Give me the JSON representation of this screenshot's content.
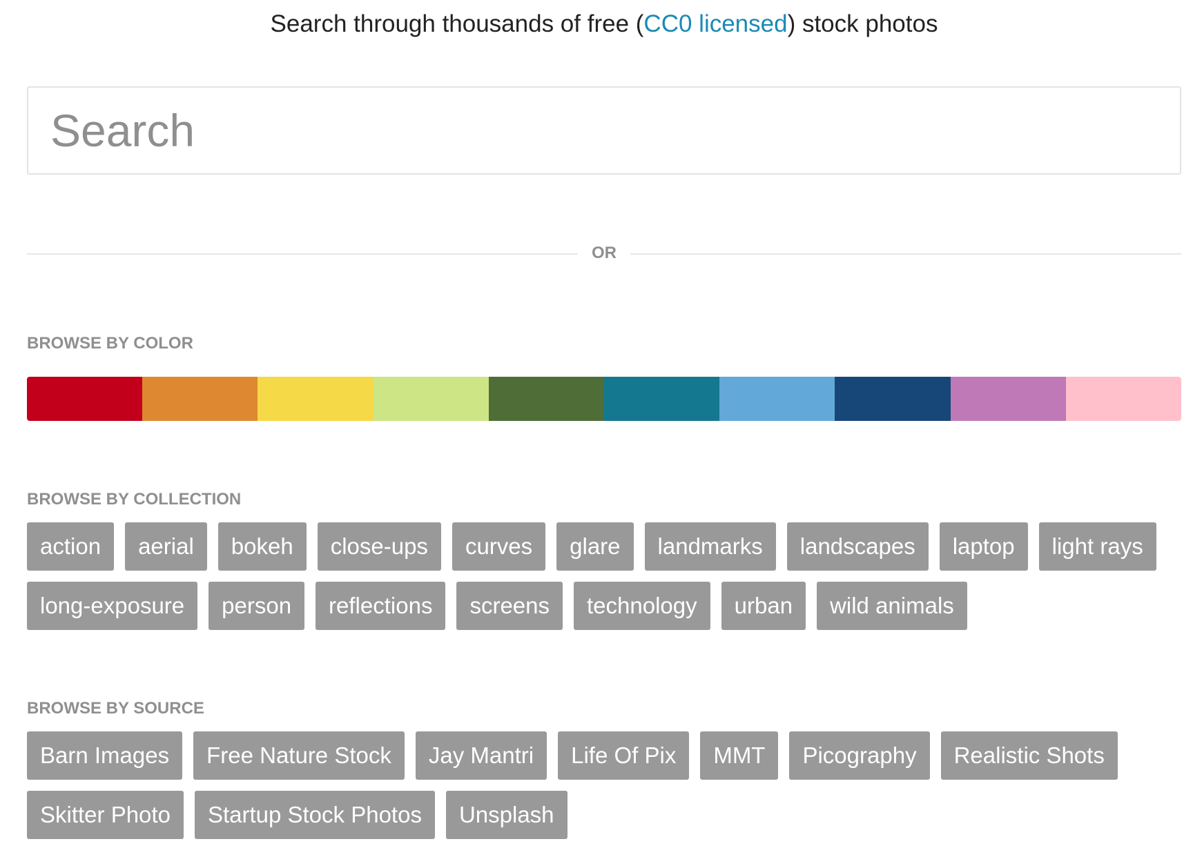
{
  "tagline": {
    "before": "Search through thousands of free (",
    "link": "CC0 licensed",
    "after": ") stock photos"
  },
  "search": {
    "placeholder": "Search",
    "value": ""
  },
  "divider": {
    "label": "OR"
  },
  "browse_color": {
    "heading": "BROWSE BY COLOR",
    "colors": [
      "#c2001b",
      "#df8832",
      "#f6d947",
      "#cde585",
      "#4f6e37",
      "#147891",
      "#62a8d8",
      "#174778",
      "#bf79b7",
      "#ffc0cc"
    ]
  },
  "browse_collection": {
    "heading": "BROWSE BY COLLECTION",
    "tags": [
      "action",
      "aerial",
      "bokeh",
      "close-ups",
      "curves",
      "glare",
      "landmarks",
      "landscapes",
      "laptop",
      "light rays",
      "long-exposure",
      "person",
      "reflections",
      "screens",
      "technology",
      "urban",
      "wild animals"
    ]
  },
  "browse_source": {
    "heading": "BROWSE BY SOURCE",
    "tags": [
      "Barn Images",
      "Free Nature Stock",
      "Jay Mantri",
      "Life Of Pix",
      "MMT",
      "Picography",
      "Realistic Shots",
      "Skitter Photo",
      "Startup Stock Photos",
      "Unsplash"
    ]
  }
}
